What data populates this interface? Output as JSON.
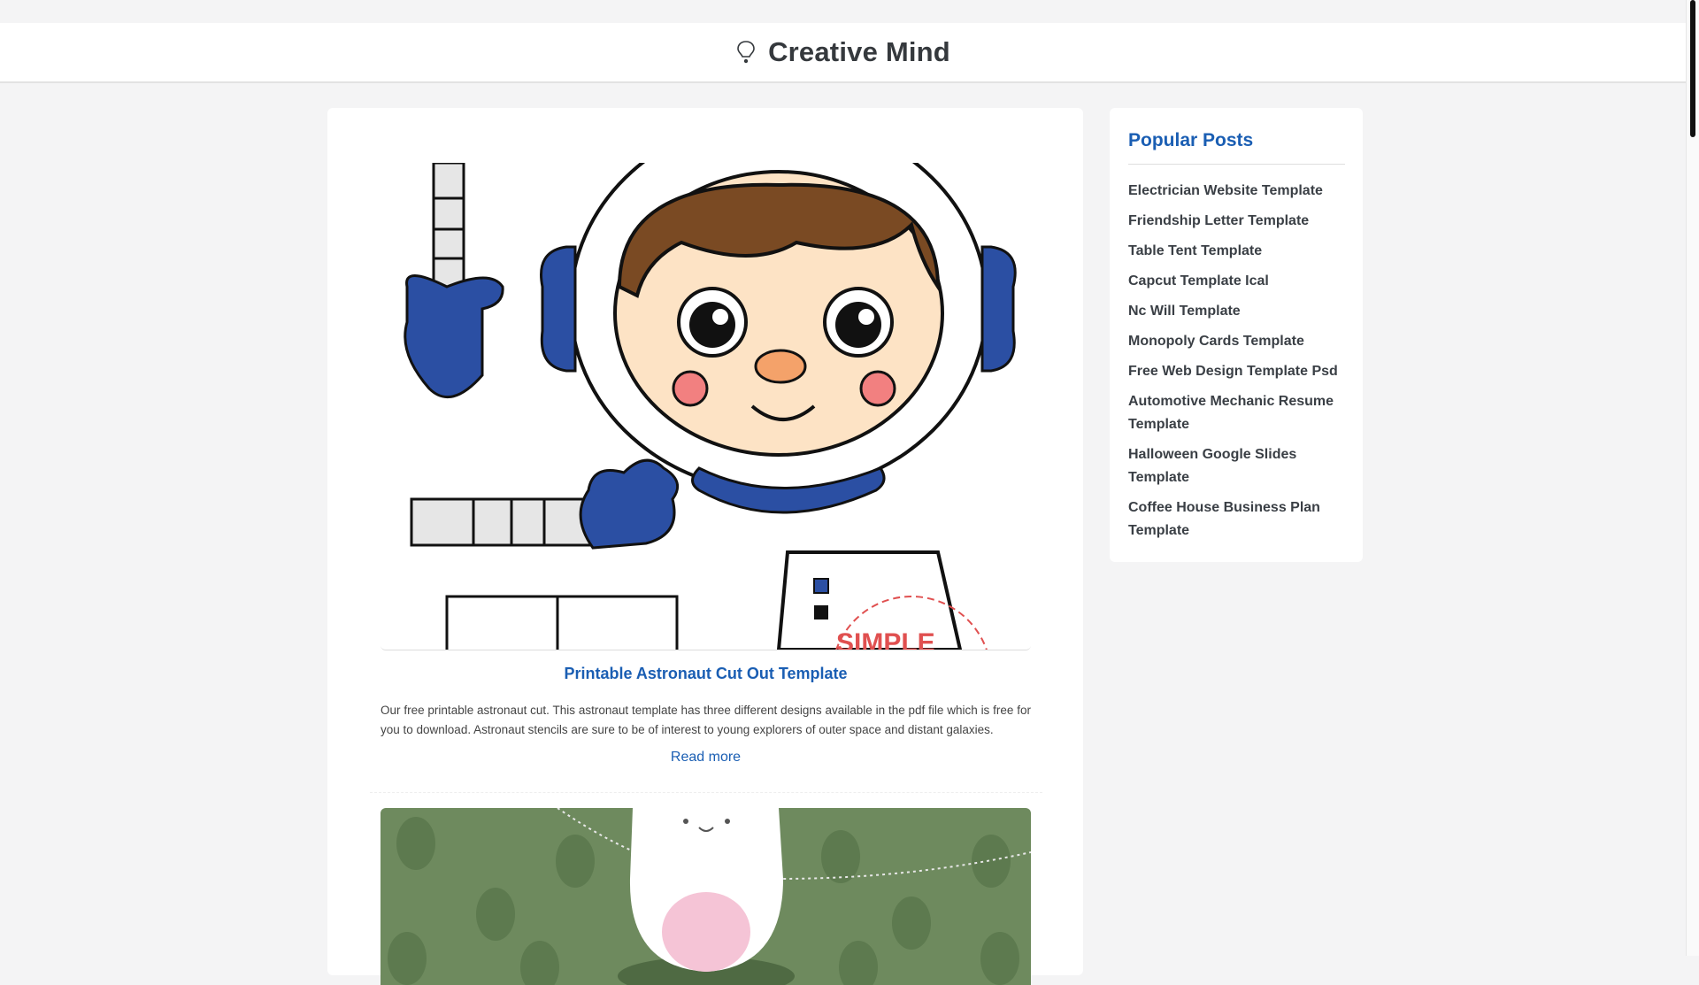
{
  "site": {
    "title": "Creative Mind",
    "icon": "lightbulb-icon"
  },
  "post": {
    "title": "Printable Astronaut Cut Out Template",
    "excerpt": "Our free printable astronaut cut. This astronaut template has three different designs available in the pdf file which is free for you to download. Astronaut stencils are sure to be of interest to young explorers of outer space and distant galaxies.",
    "read_more": "Read more",
    "image_watermark": "SIMPLE"
  },
  "sidebar": {
    "title": "Popular Posts",
    "items": [
      "Electrician Website Template",
      "Friendship Letter Template",
      "Table Tent Template",
      "Capcut Template Ical",
      "Nc Will Template",
      "Monopoly Cards Template",
      "Free Web Design Template Psd",
      "Automotive Mechanic Resume Template",
      "Halloween Google Slides Template",
      "Coffee House Business Plan Template"
    ]
  },
  "colors": {
    "accent": "#1a5eb3",
    "page_bg": "#f4f4f5",
    "astronaut_blue": "#2b4fa3",
    "second_image_bg": "#6e8a5e"
  }
}
